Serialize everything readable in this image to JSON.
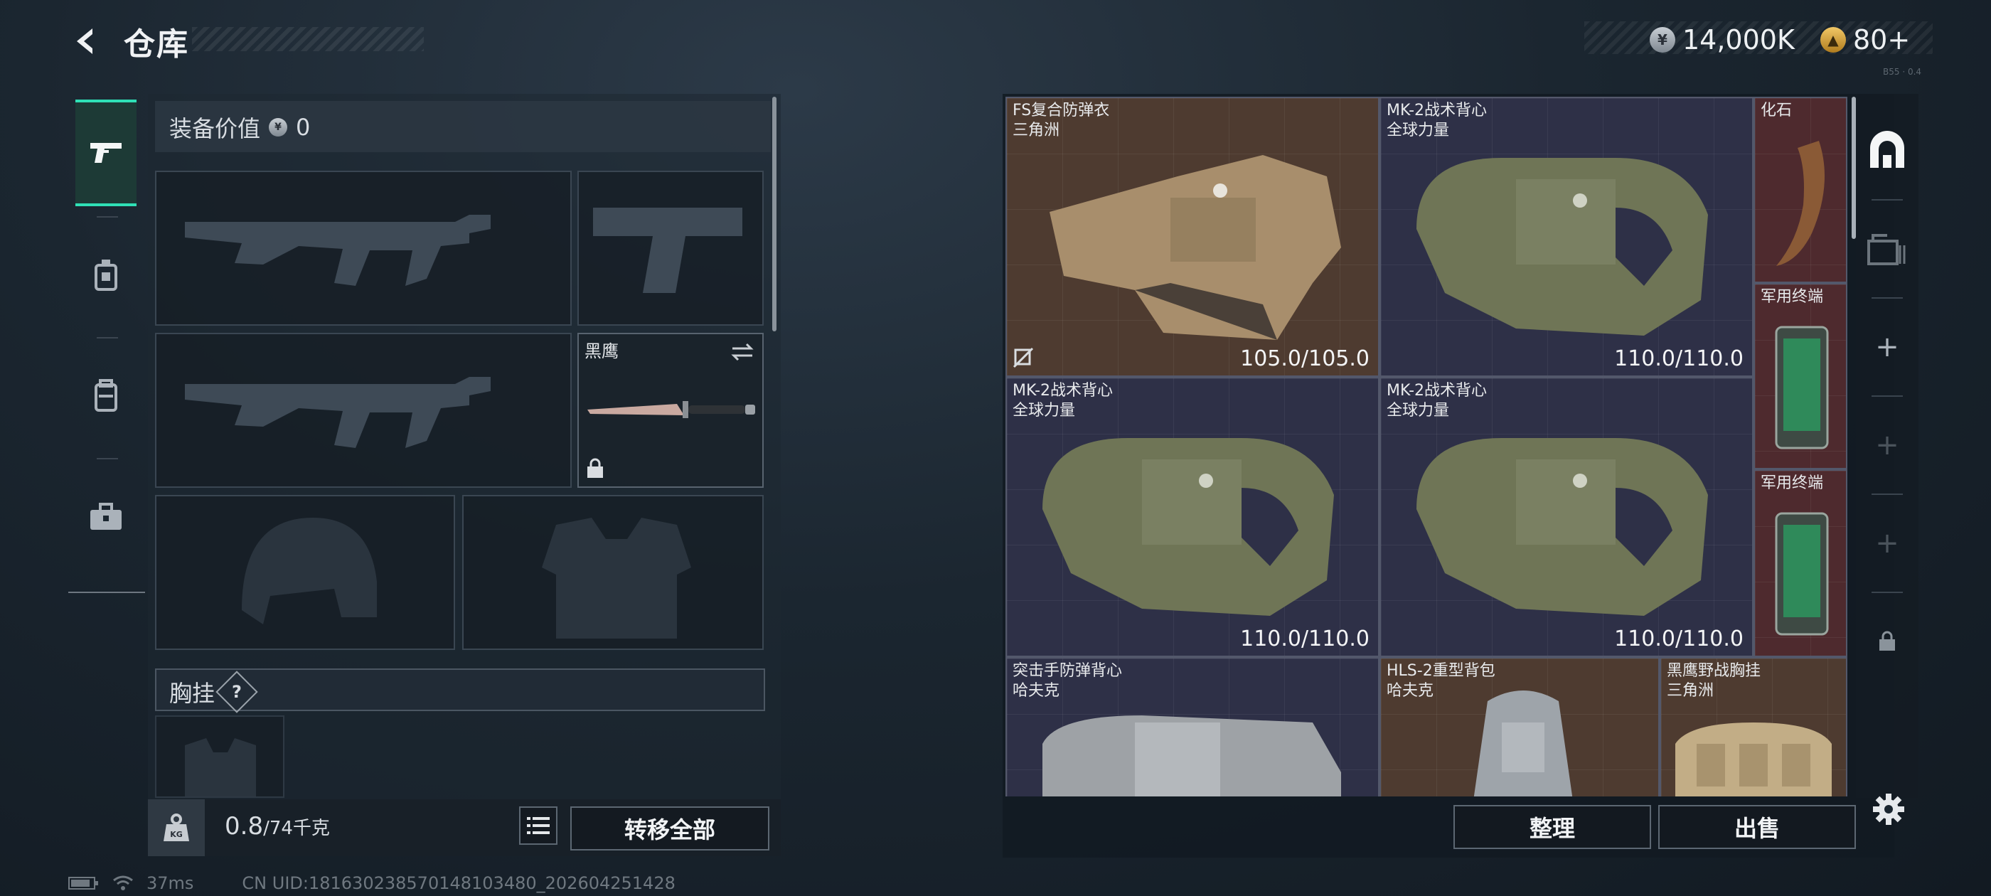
{
  "header": {
    "title": "仓库",
    "currencies": [
      {
        "icon": "silver-coin-icon",
        "value": "14,000K"
      },
      {
        "icon": "gold-ticket-icon",
        "value": "80+"
      }
    ],
    "version_text": "B55 · 0.4"
  },
  "left_tabs": [
    {
      "icon": "pistol-icon",
      "active": true
    },
    {
      "icon": "ammo-pack-icon",
      "active": false
    },
    {
      "icon": "backpack-icon",
      "active": false
    },
    {
      "icon": "toolbox-icon",
      "active": false
    }
  ],
  "equipment": {
    "value_label": "装备价值",
    "value": "0",
    "melee_name": "黑鹰",
    "chest_rig_label": "胸挂",
    "help_glyph": "?"
  },
  "carry": {
    "current": "0.8",
    "max": "/74千克",
    "transfer_all": "转移全部"
  },
  "inventory": {
    "items": [
      {
        "name": "FS复合防弹衣",
        "source": "三角洲",
        "durability": "105.0/105.0",
        "bg": "brown"
      },
      {
        "name": "MK-2战术背心",
        "source": "全球力量",
        "durability": "110.0/110.0",
        "bg": "blue"
      },
      {
        "name": "化石",
        "source": "",
        "durability": "",
        "bg": "red"
      },
      {
        "name": "军用终端",
        "source": "",
        "durability": "",
        "bg": "red"
      },
      {
        "name": "MK-2战术背心",
        "source": "全球力量",
        "durability": "110.0/110.0",
        "bg": "blue"
      },
      {
        "name": "MK-2战术背心",
        "source": "全球力量",
        "durability": "110.0/110.0",
        "bg": "blue"
      },
      {
        "name": "军用终端",
        "source": "",
        "durability": "",
        "bg": "red"
      },
      {
        "name": "突击手防弹背心",
        "source": "哈夫克",
        "durability": "",
        "bg": "blue"
      },
      {
        "name": "HLS-2重型背包",
        "source": "哈夫克",
        "durability": "",
        "bg": "brown"
      },
      {
        "name": "黑鹰野战胸挂",
        "source": "三角洲",
        "durability": "",
        "bg": "brown"
      }
    ],
    "sort_label": "整理",
    "sell_label": "出售"
  },
  "right_tabs": [
    {
      "icon": "safe-box-icon"
    },
    {
      "icon": "container-icon"
    },
    {
      "icon": "plus-icon",
      "glyph": "+"
    },
    {
      "icon": "plus-icon",
      "glyph": "+"
    },
    {
      "icon": "plus-icon",
      "glyph": "+"
    },
    {
      "icon": "lock-icon"
    }
  ],
  "status_bar": {
    "ping": "37ms",
    "uid": "CN UID:18163023857014810348​0_202604251428"
  },
  "colors": {
    "accent": "#2fe0b6",
    "brown_cell": "#4e3b30",
    "blue_cell": "#2e3047",
    "red_cell": "#4e2a2e"
  }
}
